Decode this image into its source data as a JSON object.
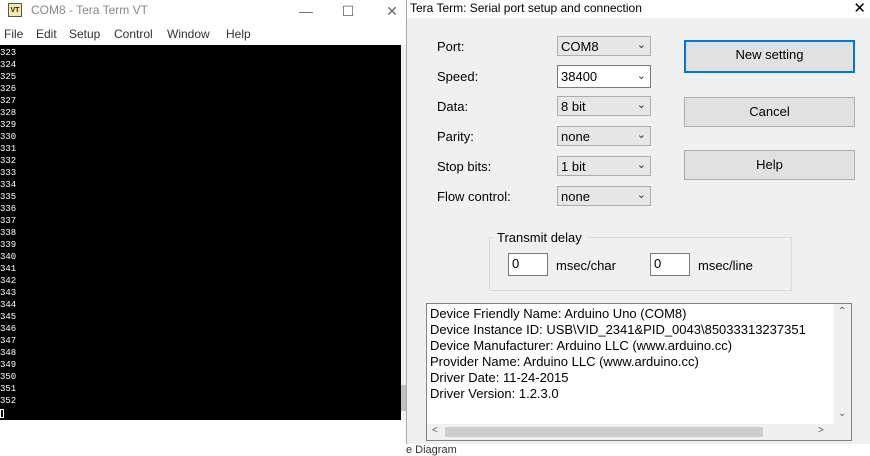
{
  "main_window": {
    "app_icon": "VT",
    "title": "COM8 - Tera Term VT",
    "controls": [
      "—",
      "☐",
      "✕"
    ],
    "menu": [
      "File",
      "Edit",
      "Setup",
      "Control",
      "Window",
      "Help"
    ],
    "terminal_lines": [
      "323",
      "324",
      "325",
      "326",
      "327",
      "328",
      "329",
      "330",
      "331",
      "332",
      "333",
      "334",
      "335",
      "336",
      "337",
      "338",
      "339",
      "340",
      "341",
      "342",
      "343",
      "344",
      "345",
      "346",
      "347",
      "348",
      "349",
      "350",
      "351",
      "352"
    ]
  },
  "dialog": {
    "title": "Tera Term: Serial port setup and connection",
    "close": "✕",
    "fields": [
      {
        "label": "Port:",
        "value": "COM8"
      },
      {
        "label": "Speed:",
        "value": "38400"
      },
      {
        "label": "Data:",
        "value": "8 bit"
      },
      {
        "label": "Parity:",
        "value": "none"
      },
      {
        "label": "Stop bits:",
        "value": "1 bit"
      },
      {
        "label": "Flow control:",
        "value": "none"
      }
    ],
    "buttons": {
      "new_setting": "New setting",
      "cancel": "Cancel",
      "help": "Help"
    },
    "transmit_delay": {
      "legend": "Transmit delay",
      "char_value": "0",
      "char_unit": "msec/char",
      "line_value": "0",
      "line_unit": "msec/line"
    },
    "info_lines": [
      "Device Friendly Name: Arduino Uno (COM8)",
      "Device Instance ID: USB\\VID_2341&PID_0043\\85033313237351",
      "Device Manufacturer: Arduino LLC (www.arduino.cc)",
      "Provider Name: Arduino LLC (www.arduino.cc)",
      "Driver Date: 11-24-2015",
      "Driver Version: 1.2.3.0"
    ]
  },
  "background_text": "e Diagram",
  "colors": {
    "accent": "#0078d7",
    "terminal_bg": "#000000",
    "terminal_fg": "#ffffff",
    "dialog_bg": "#f0f0f0"
  }
}
